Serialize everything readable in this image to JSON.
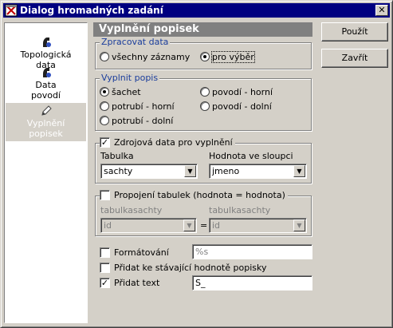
{
  "window": {
    "title": "Dialog hromadných zadání",
    "close_glyph": "✕"
  },
  "nav": {
    "items": [
      {
        "label_line1": "Topologická",
        "label_line2": "data",
        "icon": "topology-data-icon",
        "selected": false
      },
      {
        "label_line1": "Data",
        "label_line2": "povodí",
        "icon": "basin-data-icon",
        "selected": false
      },
      {
        "label_line1": "Vyplnění",
        "label_line2": "popisek",
        "icon": "pencil-icon",
        "selected": true
      }
    ]
  },
  "heading": "Vyplnění popisek",
  "buttons": {
    "apply": "Použít",
    "close": "Zavřít"
  },
  "process": {
    "legend": "Zpracovat data",
    "all_records": "všechny záznamy",
    "selection": "pro výběr",
    "selected": "pro výběr"
  },
  "fill": {
    "legend": "Vyplnit popis",
    "options": [
      "šachet",
      "potrubí - horní",
      "potrubí - dolní",
      "povodí - horní",
      "povodí - dolní"
    ],
    "selected": "šachet"
  },
  "source": {
    "label": "Zdrojová data pro vyplnění",
    "checked": true,
    "table_label": "Tabulka",
    "table_value": "sachty",
    "column_label": "Hodnota ve sloupci",
    "column_value": "jmeno"
  },
  "join": {
    "label": "Propojení tabulek (hodnota = hodnota)",
    "checked": false,
    "left_table": "tabulkasachty",
    "left_value": "id",
    "equals": "=",
    "right_table": "tabulkasachty",
    "right_value": "id"
  },
  "options": {
    "format_label": "Formátování",
    "format_checked": false,
    "format_value": "%s",
    "append_label": "Přidat ke stávající hodnotě popisky",
    "append_checked": false,
    "addtext_label": "Přidat text",
    "addtext_checked": true,
    "addtext_value": "S_"
  },
  "colors": {
    "title_bar": "#000080",
    "heading_bg": "#808080",
    "group_legend": "#1b3e9c",
    "face": "#d4d0c8"
  }
}
